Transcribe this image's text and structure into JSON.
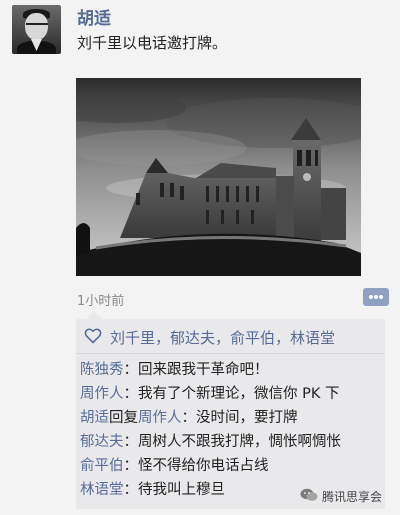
{
  "post": {
    "author": "胡适",
    "text": "刘千里以电话邀打牌。",
    "time": "1小时前"
  },
  "likes": {
    "names": "刘千里，郁达夫，俞平伯，林语堂"
  },
  "comments": [
    {
      "name": "陈独秀",
      "text": "：回来跟我干革命吧！"
    },
    {
      "name": "周作人",
      "text": "：我有了个新理论，微信你 PK 下"
    },
    {
      "name": "胡适",
      "reply_word": "回复",
      "reply_to": "周作人",
      "text": "：没时间，要打牌"
    },
    {
      "name": "郁达夫",
      "text": "：周树人不跟我打牌，惆怅啊惆怅"
    },
    {
      "name": "俞平伯",
      "text": "：怪不得给你电话占线"
    },
    {
      "name": "林语堂",
      "text": "：待我叫上穆旦"
    }
  ],
  "watermark": "腾讯思享会",
  "icons": {
    "avatar": "portrait-avatar",
    "like": "heart-outline-icon",
    "more": "more-dots-icon",
    "watermark": "wechat-logo-icon"
  },
  "colors": {
    "name": "#576b95",
    "background": "#f3f3f3",
    "comment_panel": "#e9e9ec"
  }
}
